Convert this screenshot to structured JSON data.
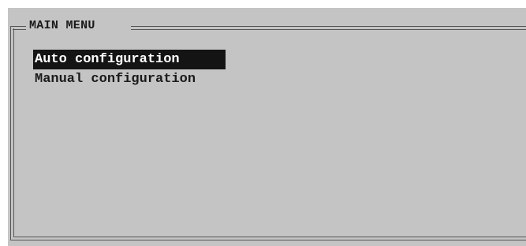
{
  "menu": {
    "title": "MAIN MENU",
    "items": [
      {
        "label": "Auto configuration",
        "selected": true
      },
      {
        "label": "Manual configuration",
        "selected": false
      }
    ]
  },
  "colors": {
    "background": "#c4c4c4",
    "frame": "#555555",
    "highlight_bg": "#141414",
    "highlight_text": "#ffffff",
    "text": "#1a1a1a"
  }
}
